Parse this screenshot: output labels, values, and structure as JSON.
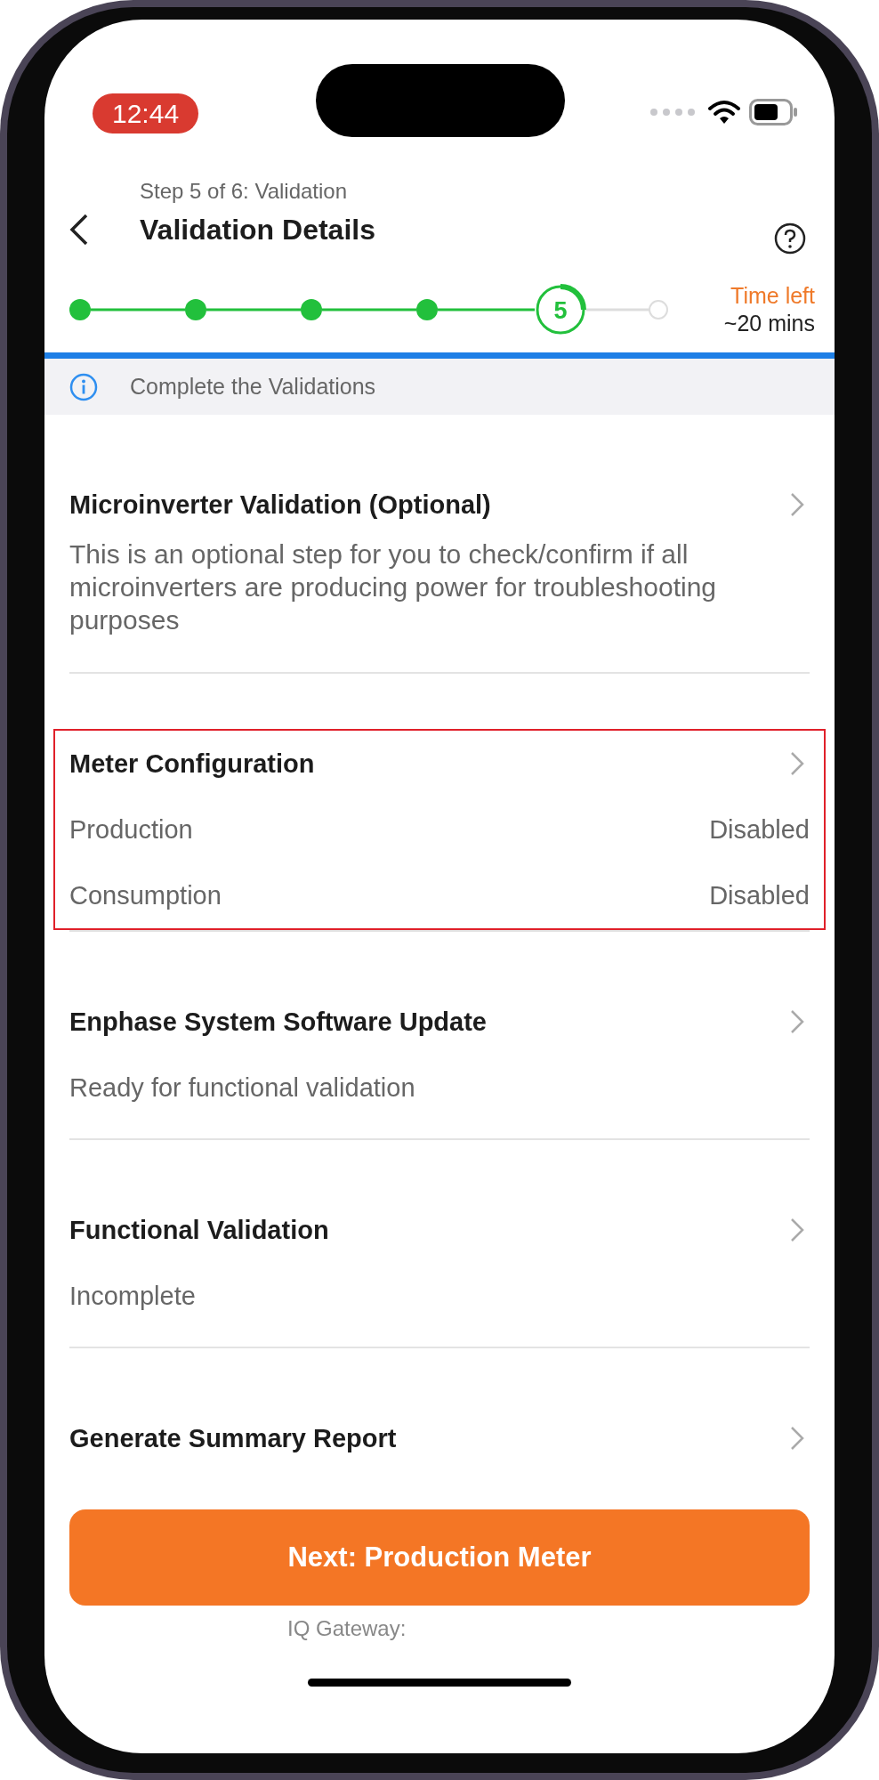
{
  "status_bar": {
    "time": "12:44"
  },
  "header": {
    "step": "Step 5 of 6: Validation",
    "title": "Validation Details"
  },
  "progress": {
    "steps": [
      {
        "kind": "done"
      },
      {
        "kind": "done"
      },
      {
        "kind": "done"
      },
      {
        "kind": "done"
      },
      {
        "kind": "current",
        "label": "5"
      },
      {
        "kind": "pending"
      }
    ],
    "time_label": "Time left",
    "time_value": "~20 mins"
  },
  "banner": {
    "text": "Complete the Validations"
  },
  "sections": [
    {
      "kind": "description",
      "title": "Microinverter Validation (Optional)",
      "highlighted": false,
      "description": "This is an optional step for you to check/confirm if all microinverters are producing power for troubleshooting purposes"
    },
    {
      "kind": "rows",
      "title": "Meter Configuration",
      "highlighted": true,
      "rows": [
        {
          "label": "Production",
          "value": "Disabled"
        },
        {
          "label": "Consumption",
          "value": "Disabled"
        }
      ]
    },
    {
      "kind": "status",
      "title": "Enphase System Software Update",
      "highlighted": false,
      "status": "Ready for functional validation"
    },
    {
      "kind": "status",
      "title": "Functional Validation",
      "highlighted": false,
      "status": "Incomplete"
    },
    {
      "kind": "status",
      "title": "Generate Summary Report",
      "highlighted": false
    }
  ],
  "next_button": {
    "label": "Next: Production Meter"
  },
  "footer": {
    "gateway_label": "IQ Gateway:"
  }
}
